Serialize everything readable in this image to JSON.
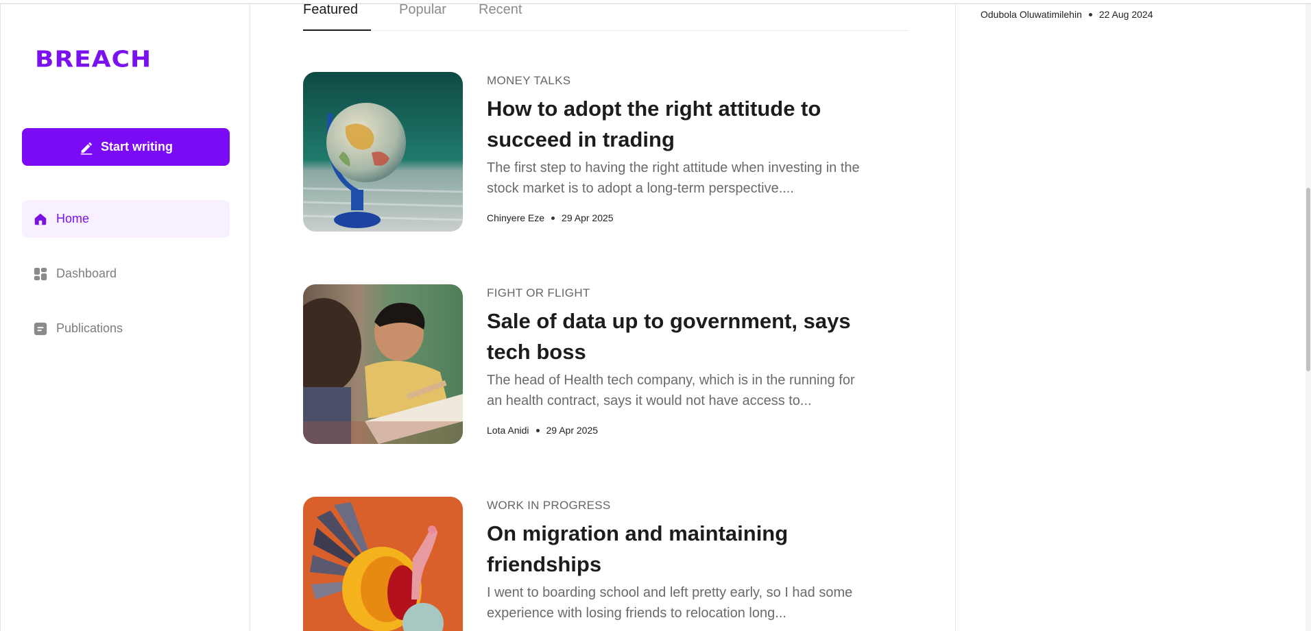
{
  "sidebar": {
    "logo": "BREACH",
    "start_writing_label": "Start writing",
    "items": [
      {
        "label": "Home",
        "icon": "home-icon",
        "active": true
      },
      {
        "label": "Dashboard",
        "icon": "dashboard-icon",
        "active": false
      },
      {
        "label": "Publications",
        "icon": "publications-icon",
        "active": false
      }
    ]
  },
  "tabs": [
    {
      "label": "Featured",
      "active": true
    },
    {
      "label": "Popular",
      "active": false
    },
    {
      "label": "Recent",
      "active": false
    }
  ],
  "articles": [
    {
      "category": "MONEY TALKS",
      "title": "How to adopt the right attitude to succeed in trading",
      "excerpt": "The first step to having the right attitude when investing in the stock market is to adopt a long-term perspective....",
      "author": "Chinyere Eze",
      "date": "29 Apr 2025",
      "image": "globe-photo"
    },
    {
      "category": "FIGHT OR FLIGHT",
      "title": "Sale of data up to government, says tech boss",
      "excerpt": "The head of Health tech company, which is in the running for an health contract, says it would not have access to...",
      "author": "Lota Anidi",
      "date": "29 Apr 2025",
      "image": "student-photo"
    },
    {
      "category": "WORK IN PROGRESS",
      "title": "On migration and maintaining friendships",
      "excerpt": "I went to boarding school and left pretty early, so I had some experience with losing friends to relocation long...",
      "author": "",
      "date": "",
      "image": "paper-turkey-photo"
    }
  ],
  "right_panel": {
    "author": "Odubola Oluwatimilehin",
    "date": "22 Aug 2024"
  },
  "colors": {
    "accent": "#7b0bf5",
    "active_nav_bg": "#f8f0ff",
    "muted_text": "#7d7d7d"
  }
}
